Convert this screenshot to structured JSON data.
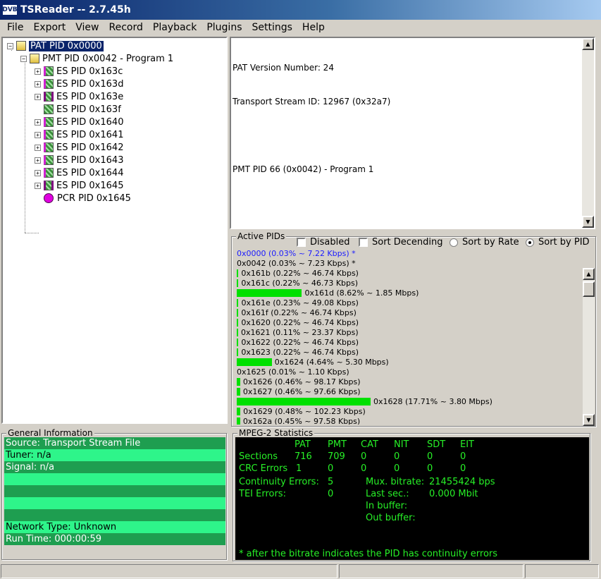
{
  "window": {
    "icon_text": "DVB",
    "title": "TSReader -- 2.7.45h"
  },
  "menu": [
    "File",
    "Export",
    "View",
    "Record",
    "Playback",
    "Plugins",
    "Settings",
    "Help"
  ],
  "tree": {
    "root": "PAT PID 0x0000",
    "pmt": "PMT PID 0x0042 - Program 1",
    "es_items": [
      {
        "label": "ES PID 0x163c",
        "expandable": true,
        "icon": "video-stream-icon"
      },
      {
        "label": "ES PID 0x163d",
        "expandable": true,
        "icon": "video-stream-icon"
      },
      {
        "label": "ES PID 0x163e",
        "expandable": true,
        "icon": "recorded-stream-icon"
      },
      {
        "label": "ES PID 0x163f",
        "expandable": false,
        "icon": "data-stream-icon"
      },
      {
        "label": "ES PID 0x1640",
        "expandable": true,
        "icon": "video-stream-icon"
      },
      {
        "label": "ES PID 0x1641",
        "expandable": true,
        "icon": "video-stream-icon"
      },
      {
        "label": "ES PID 0x1642",
        "expandable": true,
        "icon": "video-stream-icon"
      },
      {
        "label": "ES PID 0x1643",
        "expandable": true,
        "icon": "video-stream-icon"
      },
      {
        "label": "ES PID 0x1644",
        "expandable": true,
        "icon": "video-stream-icon"
      },
      {
        "label": "ES PID 0x1645",
        "expandable": true,
        "icon": "recorded-stream-icon"
      }
    ],
    "pcr": "PCR PID 0x1645"
  },
  "info": {
    "lines": [
      "PAT Version Number: 24",
      "Transport Stream ID: 12967 (0x32a7)",
      "",
      "PMT PID 66 (0x0042) - Program 1"
    ]
  },
  "active_pids": {
    "title": "Active PIDs",
    "options": {
      "disabled": "Disabled",
      "sort_desc": "Sort Decending",
      "sort_rate": "Sort by Rate",
      "sort_pid": "Sort by PID",
      "selected": "Sort by PID"
    },
    "rows": [
      {
        "text": "0x0000 (0.03% ~ 7.22 Kbps) *",
        "percent": 0.03,
        "highlight": true
      },
      {
        "text": "0x0042 (0.03% ~ 7.23 Kbps) *",
        "percent": 0.03,
        "highlight": false
      },
      {
        "text": "0x161b (0.22% ~ 46.74 Kbps)",
        "percent": 0.22,
        "highlight": false
      },
      {
        "text": "0x161c (0.22% ~ 46.73 Kbps)",
        "percent": 0.22,
        "highlight": false
      },
      {
        "text": "0x161d (8.62% ~ 1.85 Mbps)",
        "percent": 8.62,
        "highlight": false
      },
      {
        "text": "0x161e (0.23% ~ 49.08 Kbps)",
        "percent": 0.23,
        "highlight": false
      },
      {
        "text": "0x161f (0.22% ~ 46.74 Kbps)",
        "percent": 0.22,
        "highlight": false
      },
      {
        "text": "0x1620 (0.22% ~ 46.74 Kbps)",
        "percent": 0.22,
        "highlight": false
      },
      {
        "text": "0x1621 (0.11% ~ 23.37 Kbps)",
        "percent": 0.11,
        "highlight": false
      },
      {
        "text": "0x1622 (0.22% ~ 46.74 Kbps)",
        "percent": 0.22,
        "highlight": false
      },
      {
        "text": "0x1623 (0.22% ~ 46.74 Kbps)",
        "percent": 0.22,
        "highlight": false
      },
      {
        "text": "0x1624 (4.64% ~ 5.30 Mbps)",
        "percent": 4.64,
        "highlight": false
      },
      {
        "text": "0x1625 (0.01% ~ 1.10 Kbps)",
        "percent": 0.01,
        "highlight": false
      },
      {
        "text": "0x1626 (0.46% ~ 98.17 Kbps)",
        "percent": 0.46,
        "highlight": false
      },
      {
        "text": "0x1627 (0.46% ~ 97.66 Kbps)",
        "percent": 0.46,
        "highlight": false
      },
      {
        "text": "0x1628 (17.71% ~ 3.80 Mbps)",
        "percent": 17.71,
        "highlight": false
      },
      {
        "text": "0x1629 (0.48% ~ 102.23 Kbps)",
        "percent": 0.48,
        "highlight": false
      },
      {
        "text": "0x162a (0.45% ~ 97.58 Kbps)",
        "percent": 0.45,
        "highlight": false
      }
    ]
  },
  "general_info": {
    "title": "General Information",
    "rows": [
      "Source: Transport Stream File",
      "Tuner: n/a",
      "Signal: n/a",
      "",
      "",
      "",
      "",
      "Network Type: Unknown",
      "Run Time: 000:00:59"
    ]
  },
  "mpeg_stats": {
    "title": "MPEG-2 Statistics",
    "headers": [
      "PAT",
      "PMT",
      "CAT",
      "NIT",
      "SDT",
      "EIT"
    ],
    "sections_label": "Sections",
    "sections": [
      "716",
      "709",
      "0",
      "0",
      "0",
      "0"
    ],
    "crc_label": "CRC Errors",
    "crc": [
      "1",
      "0",
      "0",
      "0",
      "0",
      "0"
    ],
    "continuity_label": "Continuity Errors:",
    "continuity": "5",
    "tei_label": "TEI Errors:",
    "tei": "0",
    "mux_label": "Mux. bitrate:",
    "mux": "21455424 bps",
    "lastsec_label": "Last sec.:",
    "lastsec": "0.000 Mbit",
    "inbuf_label": "In buffer:",
    "outbuf_label": "Out buffer:",
    "footnote": "* after the bitrate indicates the PID has continuity errors"
  },
  "colors": {
    "title_bar": "#0a246a",
    "bar_green": "#00e000",
    "stats_text": "#27f027",
    "gi_dark": "#1e9e50",
    "gi_light": "#2ef58a"
  }
}
